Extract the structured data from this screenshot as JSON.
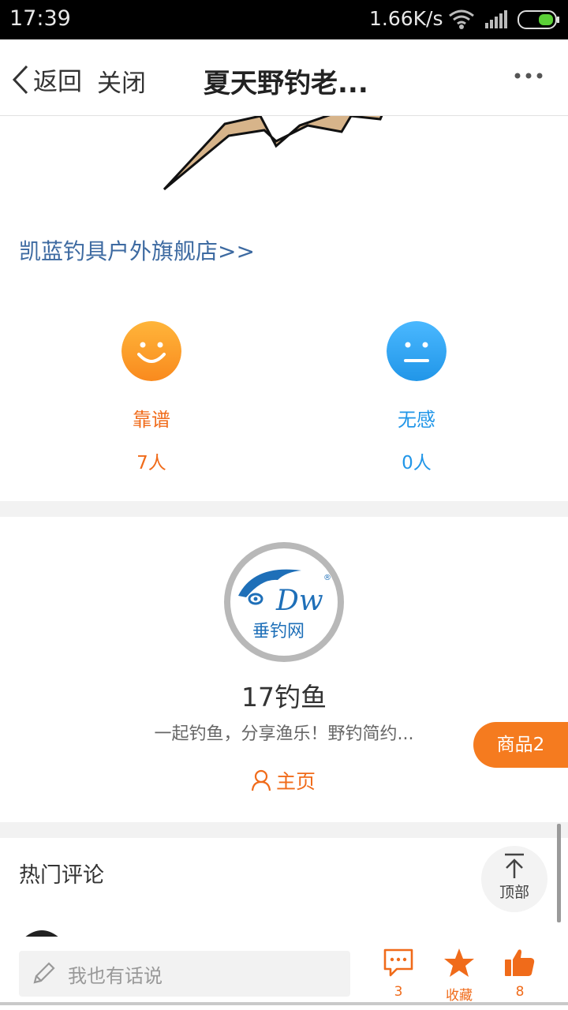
{
  "status_bar": {
    "time": "17:39",
    "network_speed": "1.66K/s",
    "icons": [
      "wifi-icon",
      "signal-icon",
      "battery-icon"
    ]
  },
  "nav": {
    "back_label": "返回",
    "close_label": "关闭",
    "title": "夏天野钓老...",
    "more_icon": "more-icon"
  },
  "shop_link": "凯蓝钓具户外旗舰店>>",
  "ratings": [
    {
      "label": "靠谱",
      "count": "7人",
      "color": "#f06b1a",
      "face": "smile"
    },
    {
      "label": "无感",
      "count": "0人",
      "color": "#2196e8",
      "face": "neutral"
    }
  ],
  "author": {
    "logo_text": "垂钓网",
    "name": "17钓鱼",
    "description": "一起钓鱼，分享渔乐！野钓简约...",
    "home_label": "主页",
    "goods_label": "商品2"
  },
  "comments": {
    "heading": "热门评论",
    "top_label": "顶部"
  },
  "bottom_bar": {
    "input_placeholder": "我也有话说",
    "comment_count": "3",
    "favorite_label": "收藏",
    "like_count": "8"
  },
  "colors": {
    "accent": "#f06b1a",
    "link": "#3d6aa1",
    "neutral_blue": "#2196e8",
    "separator": "#f2f2f2"
  }
}
